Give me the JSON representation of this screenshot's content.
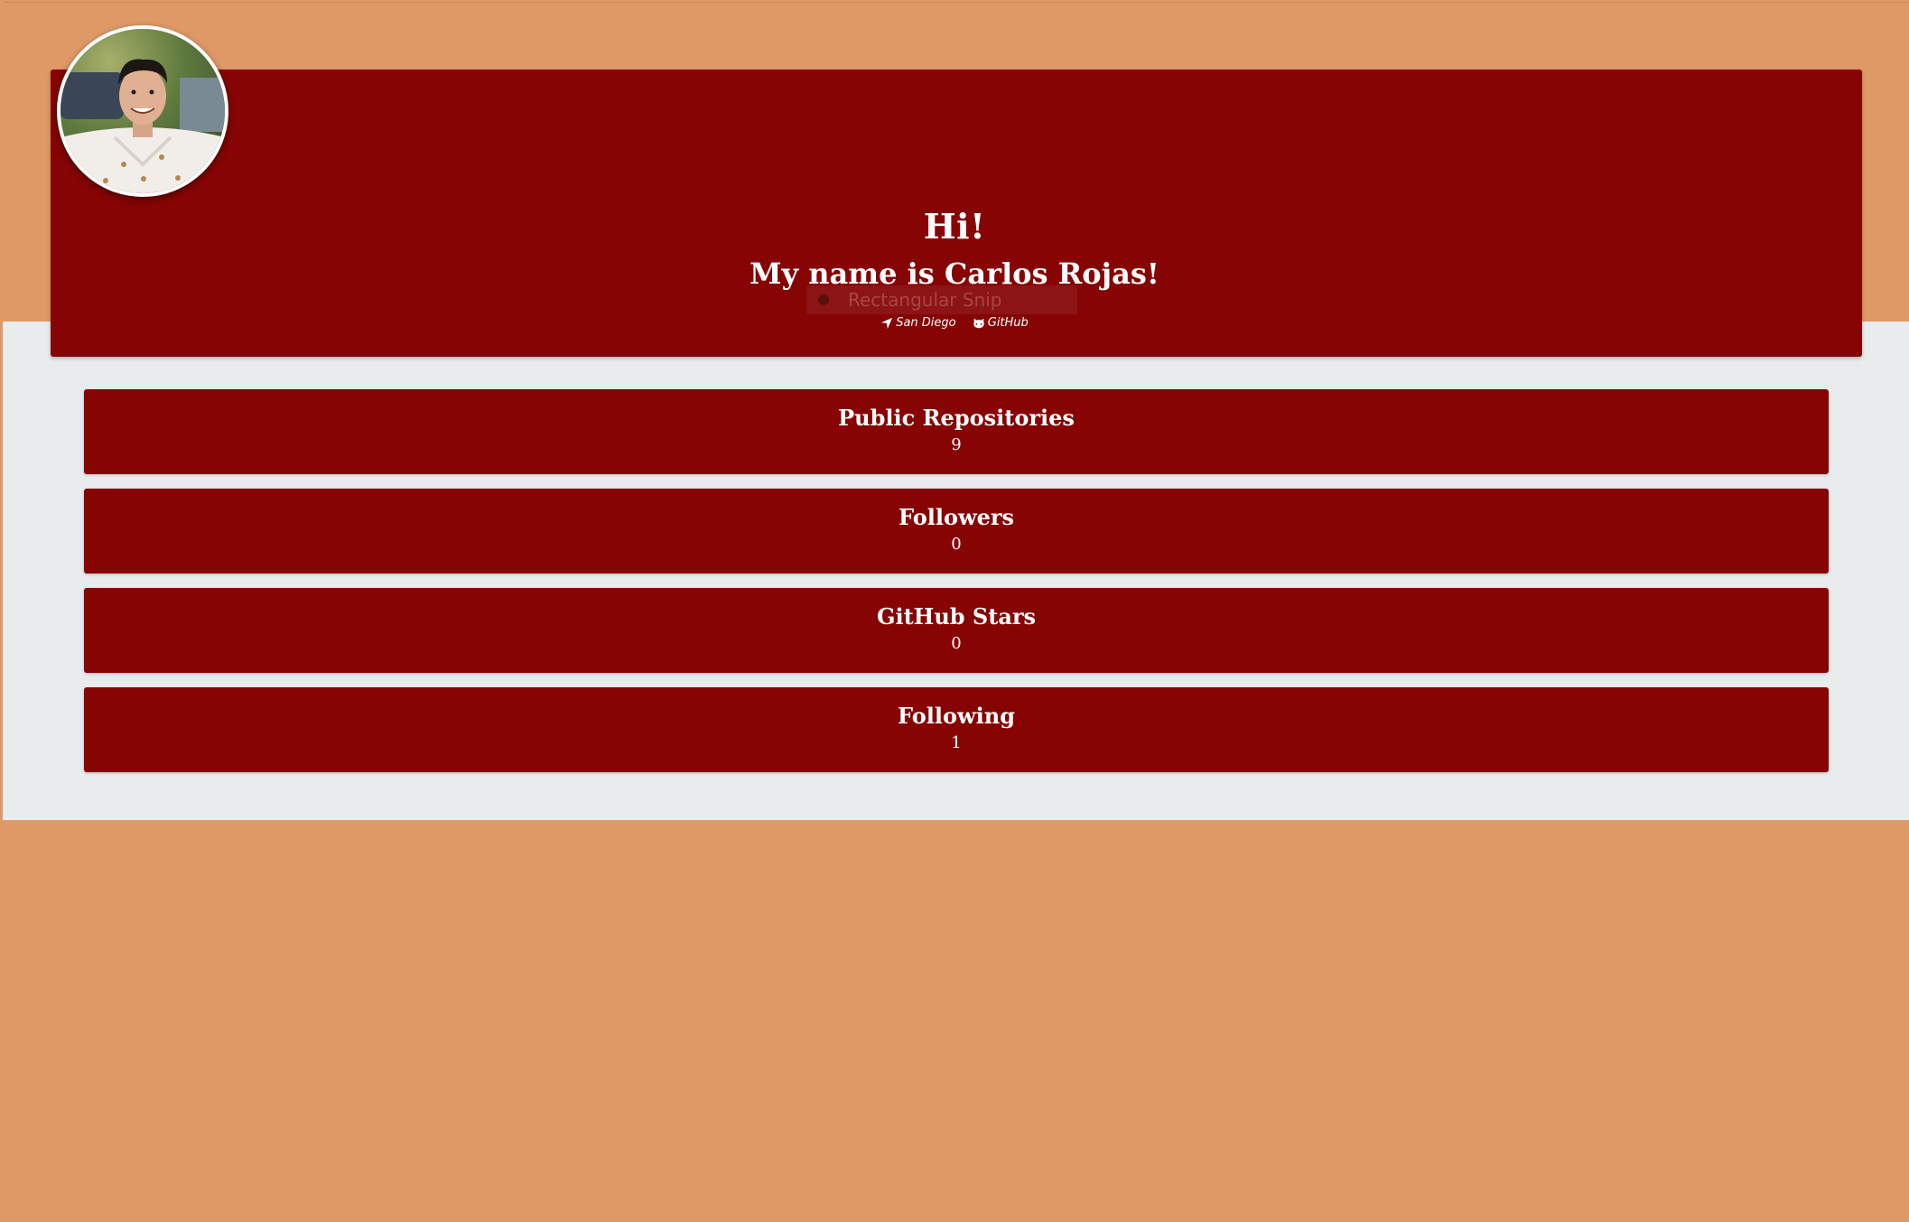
{
  "colors": {
    "outer_background": "#df9966",
    "content_background": "#e9eced",
    "card_red": "#860404",
    "text": "#ffffff"
  },
  "hero": {
    "greeting": "Hi!",
    "name": "My name is Carlos Rojas!",
    "avatar_icon": "profile-photo",
    "links": [
      {
        "icon": "location-arrow-icon",
        "label": "San Diego"
      },
      {
        "icon": "github-icon",
        "label": "GitHub"
      }
    ]
  },
  "overlay": {
    "snip_label": "Rectangular Snip"
  },
  "stats": [
    {
      "label": "Public Repositories",
      "value": "9"
    },
    {
      "label": "Followers",
      "value": "0"
    },
    {
      "label": "GitHub Stars",
      "value": "0"
    },
    {
      "label": "Following",
      "value": "1"
    }
  ]
}
